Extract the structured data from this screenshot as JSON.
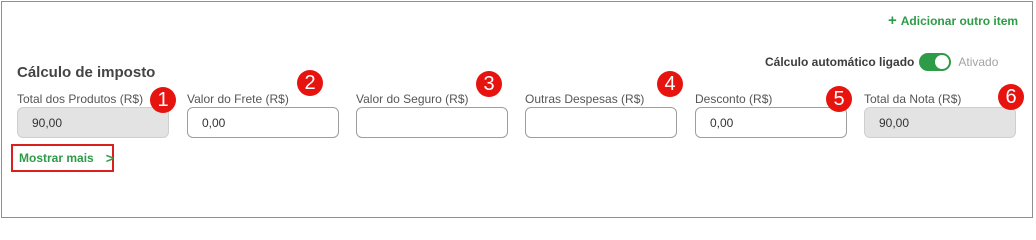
{
  "header": {
    "add_item_label": "Adicionar outro item",
    "section_title": "Cálculo de imposto"
  },
  "auto_calc": {
    "label": "Cálculo automático ligado",
    "state": "Ativado",
    "enabled": true
  },
  "fields": [
    {
      "label": "Total dos Produtos (R$)",
      "value": "90,00",
      "readonly": true,
      "badge": "1"
    },
    {
      "label": "Valor do Frete (R$)",
      "value": "0,00",
      "readonly": false,
      "badge": "2"
    },
    {
      "label": "Valor do Seguro (R$)",
      "value": "",
      "readonly": false,
      "badge": "3"
    },
    {
      "label": "Outras Despesas (R$)",
      "value": "",
      "readonly": false,
      "badge": "4"
    },
    {
      "label": "Desconto (R$)",
      "value": "0,00",
      "readonly": false,
      "badge": "5"
    },
    {
      "label": "Total da Nota (R$)",
      "value": "90,00",
      "readonly": true,
      "badge": "6"
    }
  ],
  "show_more_label": "Mostrar mais",
  "colors": {
    "accent_green": "#2e9b48",
    "badge_red": "#e6130f",
    "highlight_red": "#d9201c"
  }
}
